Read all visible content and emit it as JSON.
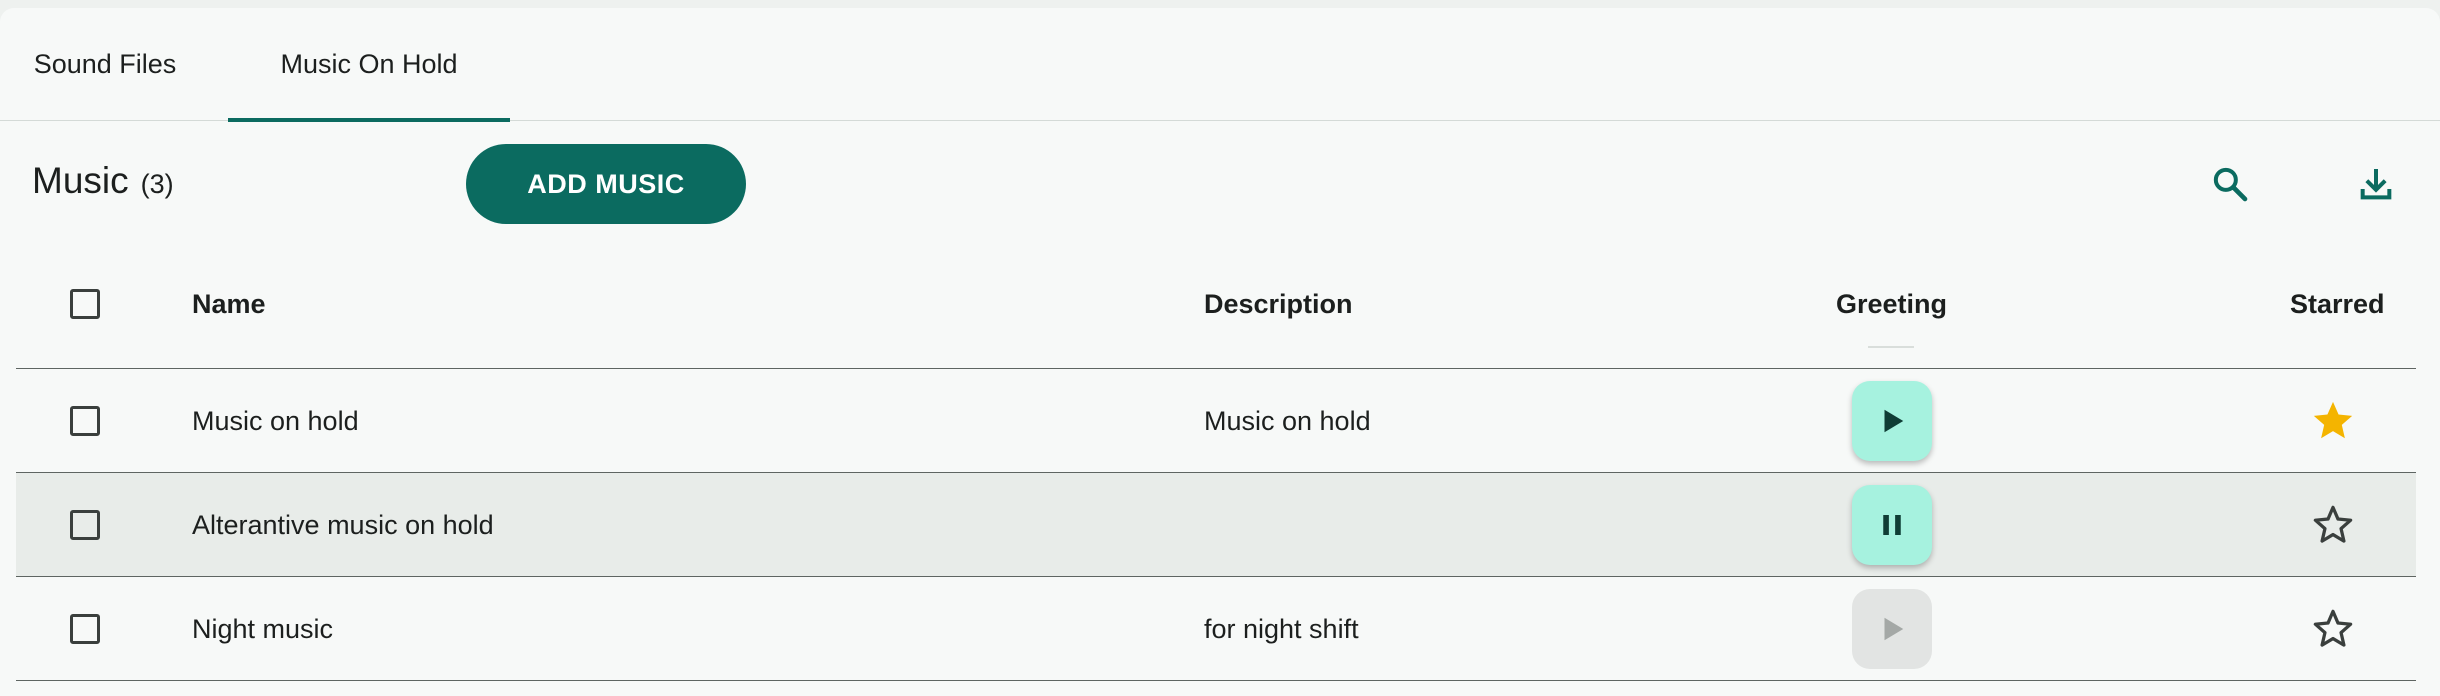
{
  "tabs": [
    {
      "label": "Sound Files",
      "active": false
    },
    {
      "label": "Music On Hold",
      "active": true
    }
  ],
  "toolbar": {
    "title": "Music",
    "count": "(3)",
    "add_label": "ADD MUSIC",
    "search_icon": "search-icon",
    "download_icon": "download-icon"
  },
  "table": {
    "columns": {
      "name": "Name",
      "description": "Description",
      "greeting": "Greeting",
      "starred": "Starred"
    },
    "rows": [
      {
        "name": "Music on hold",
        "description": "Music on hold",
        "greeting_state": "play",
        "starred": true
      },
      {
        "name": "Alterantive music on hold",
        "description": "",
        "greeting_state": "pause",
        "starred": false
      },
      {
        "name": "Night music",
        "description": "for night shift",
        "greeting_state": "play-disabled",
        "starred": false
      }
    ]
  },
  "colors": {
    "accent": "#0b6b60",
    "play_button": "#a6f2df",
    "star_filled": "#f4b400",
    "row_highlight": "#e8ece9"
  }
}
